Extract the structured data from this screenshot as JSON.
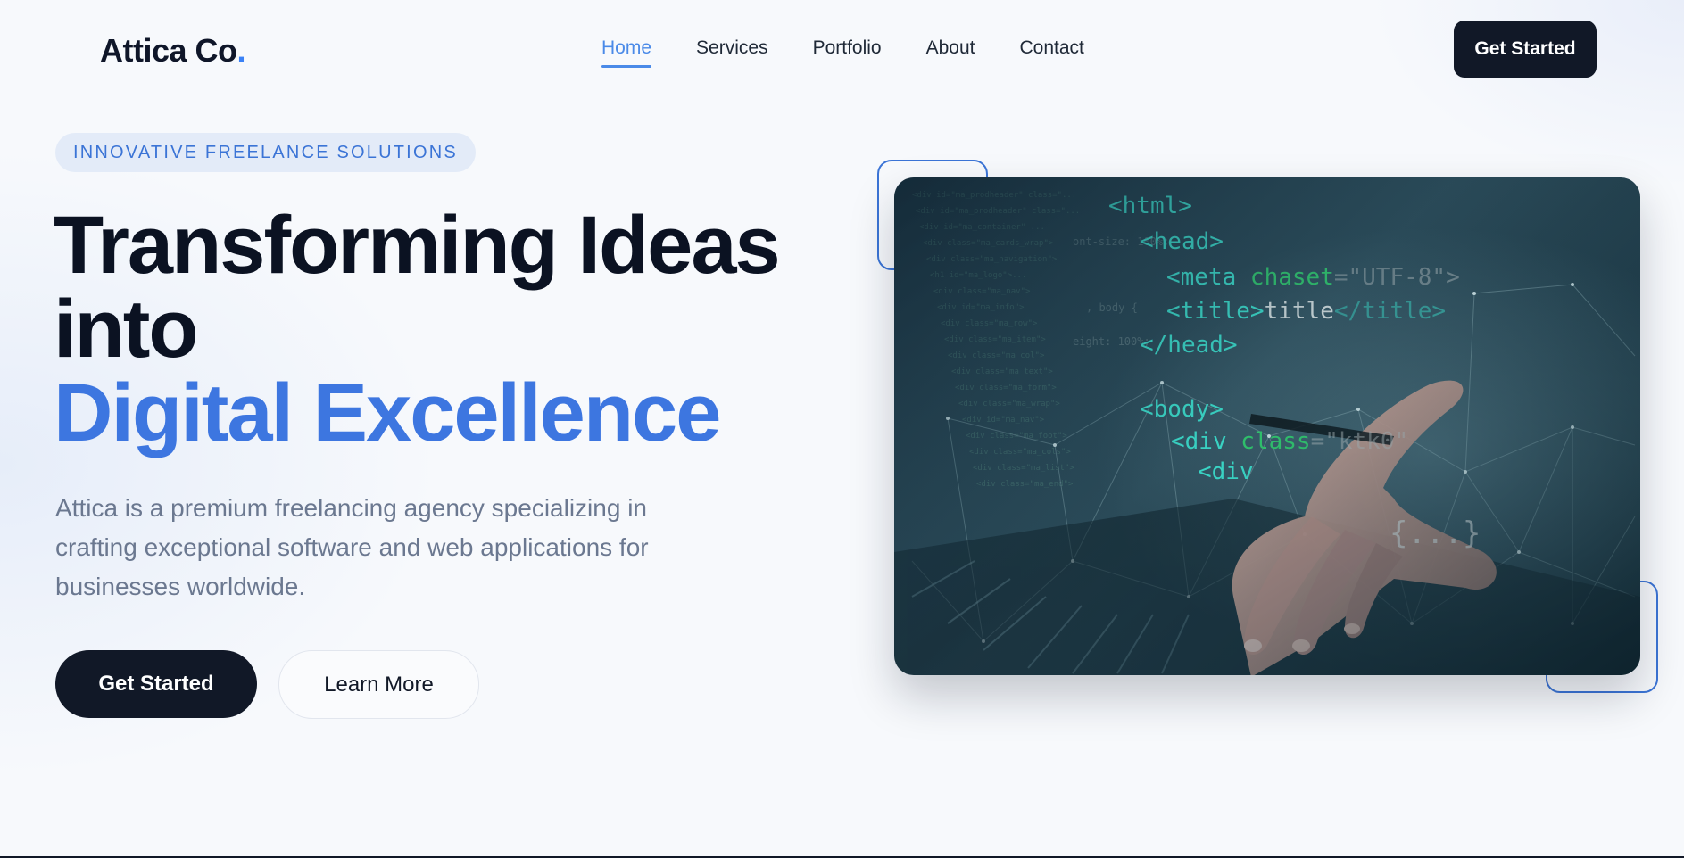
{
  "nav": {
    "logo_text": "Attica Co",
    "logo_dot": ".",
    "links": [
      {
        "label": "Home",
        "active": true
      },
      {
        "label": "Services",
        "active": false
      },
      {
        "label": "Portfolio",
        "active": false
      },
      {
        "label": "About",
        "active": false
      },
      {
        "label": "Contact",
        "active": false
      }
    ],
    "cta_label": "Get Started"
  },
  "hero": {
    "badge": "INNOVATIVE FREELANCE SOLUTIONS",
    "headline_line1": "Transforming Ideas",
    "headline_line2": "into",
    "headline_accent": "Digital Excellence",
    "subtext": "Attica is a premium freelancing agency specializing in crafting exceptional software and web applications for businesses worldwide.",
    "primary_button": "Get Started",
    "secondary_button": "Learn More",
    "image": {
      "code_lines": [
        "<html>",
        "<head>",
        "<meta chaset=\"UTF-8\">",
        "<title>title</title>",
        "</head>",
        "<body>",
        "<div class=\"ktk0\">",
        "<div",
        "{...}"
      ]
    }
  },
  "colors": {
    "accent": "#3d76e0",
    "dark": "#111827",
    "muted_text": "#6b7890",
    "badge_bg": "#e3ebf8"
  }
}
